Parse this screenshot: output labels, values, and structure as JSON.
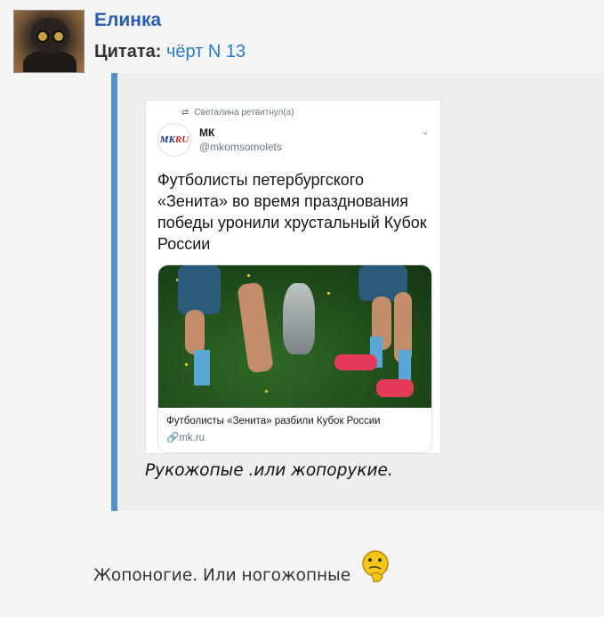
{
  "post": {
    "username": "Елинка",
    "quote_label": "Цитата:",
    "quote_author": "чёрт N 13"
  },
  "tweet": {
    "retweeted_by": "Светалина ретвитнул(а)",
    "account_name": "МК",
    "account_handle": "@mkomsomolets",
    "logo_text_a": "MK",
    "logo_text_b": "RU",
    "text": "Футболисты петербургского «Зенита» во время празднования победы уронили хрустальный Кубок России",
    "card_title": "Футболисты «Зенита» разбили Кубок России",
    "card_link": "mk.ru"
  },
  "caption": "Рукожопые .или жопорукие.",
  "reply": "Жопоногие. Или ногожопные",
  "icons": {
    "retweet": "retweet-icon",
    "chevron": "chevron-down-icon",
    "link": "link-icon",
    "smiley": "thinking-smiley-icon"
  },
  "colors": {
    "username": "#2a5db0",
    "link": "#2a7bc8",
    "quote_bar": "#5b8ed0"
  }
}
